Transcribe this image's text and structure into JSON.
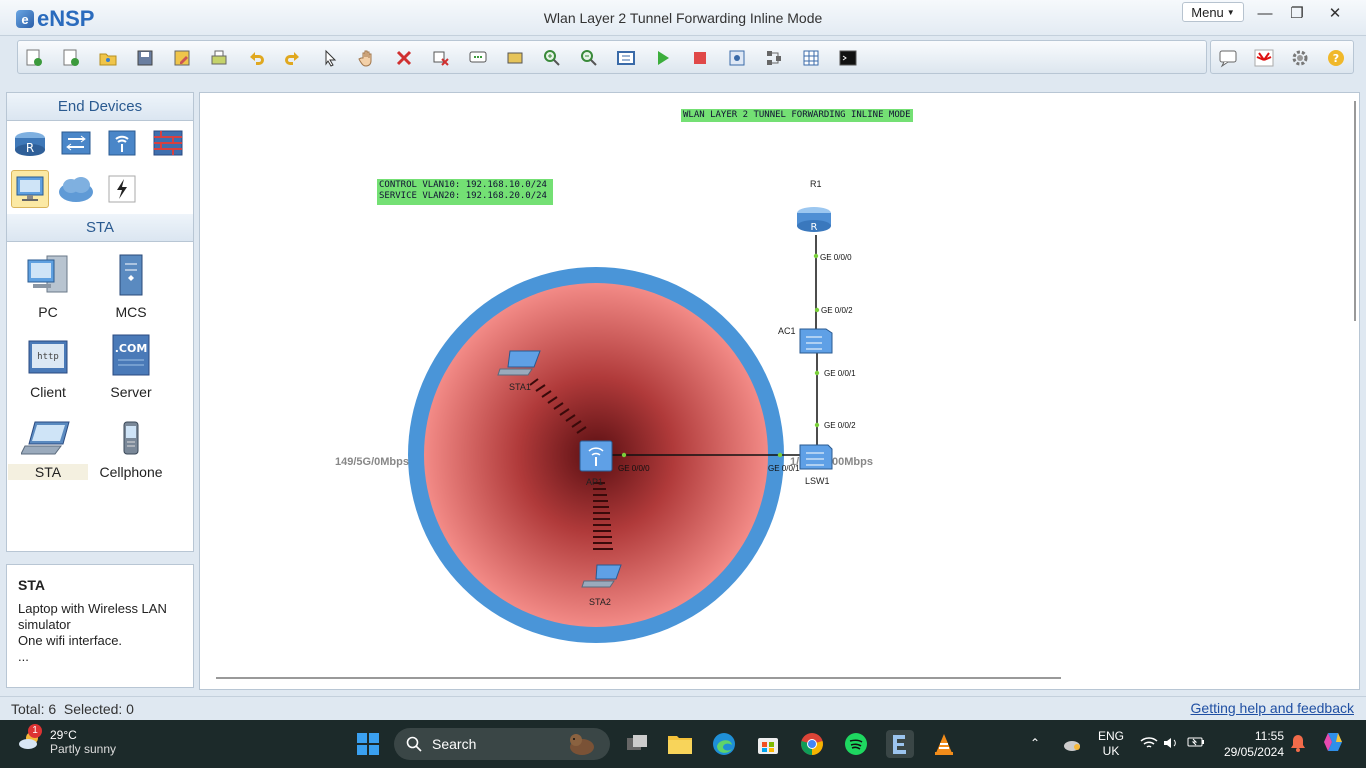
{
  "app": {
    "logo": "eNSP",
    "title": "Wlan Layer 2 Tunnel Forwarding Inline Mode",
    "menu_label": "Menu"
  },
  "toolbar": {
    "buttons": [
      "new-topology",
      "new-from-template",
      "open",
      "save",
      "save-as",
      "print",
      "undo",
      "redo",
      "select",
      "pan",
      "delete",
      "delete-links",
      "add-note",
      "add-area",
      "zoom-in",
      "zoom-out",
      "fit",
      "start-device",
      "stop-device",
      "capture-data",
      "show-interface",
      "topology-grid",
      "console"
    ],
    "right_buttons": [
      "chat",
      "huawei",
      "settings",
      "help"
    ]
  },
  "left_panel": {
    "category_header": "End Devices",
    "categories": [
      "router",
      "switch",
      "wlan",
      "firewall",
      "end-device",
      "cloud",
      "auxiliary"
    ],
    "sub_header": "STA",
    "devices": [
      {
        "label": "PC"
      },
      {
        "label": "MCS"
      },
      {
        "label": "Client"
      },
      {
        "label": "Server"
      },
      {
        "label": "STA"
      },
      {
        "label": "Cellphone"
      }
    ]
  },
  "description": {
    "title": "STA",
    "lines": [
      "Laptop with Wireless LAN simulator",
      "One wifi interface.",
      "..."
    ]
  },
  "canvas": {
    "title_note": "WLAN LAYER 2 TUNNEL FORWARDING INLINE MODE",
    "vlan_note_1": "CONTROL VLAN10: 192.168.10.0/24",
    "vlan_note_2": "SERVICE VLAN20: 192.168.20.0/24",
    "nodes": {
      "r1": "R1",
      "ac1": "AC1",
      "lsw1": "LSW1",
      "ap1": "AP1",
      "sta1": "STA1",
      "sta2": "STA2"
    },
    "ports": {
      "r1_ge000": "GE 0/0/0",
      "ac1_ge002": "GE 0/0/2",
      "ac1_ge001": "GE 0/0/1",
      "lsw1_ge002": "GE 0/0/2",
      "lsw1_ge001": "GE 0/0/1",
      "ap1_ge000": "GE 0/0/0"
    },
    "rate_left": "149/5G/0Mbps",
    "rate_right_a": "1/",
    "rate_right_b": "00Mbps"
  },
  "status": {
    "summary": "Total: 6  Selected: 0",
    "help_link": "Getting help and feedback"
  },
  "taskbar": {
    "temp": "29°C",
    "weather": "Partly sunny",
    "badge": "1",
    "search_label": "Search",
    "lang1": "ENG",
    "lang2": "UK",
    "time": "11:55",
    "date": "29/05/2024"
  },
  "colors": {
    "accent": "#2a6bbd",
    "note_green": "#74e074",
    "coverage_ring": "#4a95d8",
    "coverage_center": "#5a0f12"
  }
}
